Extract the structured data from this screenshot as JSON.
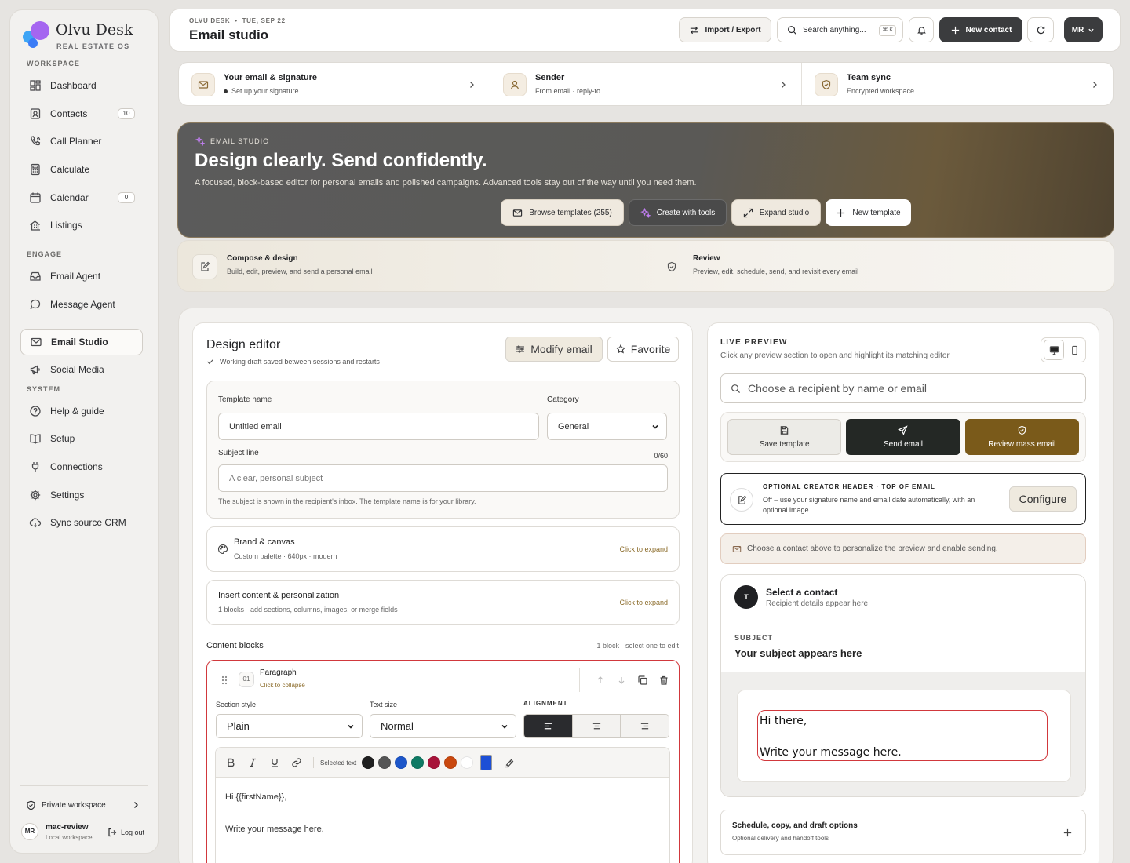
{
  "brand": {
    "name": "Olvu Desk",
    "subtitle": "REAL ESTATE OS"
  },
  "sidebar": {
    "sections": [
      "WORKSPACE",
      "ENGAGE",
      "SYSTEM"
    ],
    "items": [
      {
        "label": "Dashboard",
        "icon": "dashboard-icon"
      },
      {
        "label": "Contacts",
        "icon": "contacts-icon",
        "badge": "10"
      },
      {
        "label": "Call Planner",
        "icon": "phone-icon"
      },
      {
        "label": "Calculate",
        "icon": "calculator-icon"
      },
      {
        "label": "Calendar",
        "icon": "calendar-icon",
        "badge": "0"
      },
      {
        "label": "Listings",
        "icon": "building-icon"
      },
      {
        "label": "Email Agent",
        "icon": "inbox-icon"
      },
      {
        "label": "Message Agent",
        "icon": "chat-icon"
      },
      {
        "label": "Email Studio",
        "icon": "mail-icon",
        "active": true
      },
      {
        "label": "Social Media",
        "icon": "megaphone-icon"
      },
      {
        "label": "Help & guide",
        "icon": "help-icon"
      },
      {
        "label": "Setup",
        "icon": "book-icon"
      },
      {
        "label": "Connections",
        "icon": "plug-icon"
      },
      {
        "label": "Settings",
        "icon": "gear-icon"
      },
      {
        "label": "Sync source CRM",
        "icon": "cloud-sync-icon"
      }
    ],
    "footer": {
      "private_workspace": "Private workspace",
      "avatar": "MR",
      "user_name": "mac-review",
      "user_sub": "Local workspace",
      "logout": "Log out"
    }
  },
  "topbar": {
    "meta_app": "OLVU DESK",
    "meta_date": "TUE, SEP 22",
    "title": "Email studio",
    "import_export": "Import / Export",
    "search_placeholder": "Search anything...",
    "search_shortcut": "⌘ K",
    "new_contact": "New contact",
    "avatar": "MR"
  },
  "setup_cards": [
    {
      "title": "Your email & signature",
      "sub": "Set up your signature",
      "bullet": true
    },
    {
      "title": "Sender",
      "sub": "From email · reply-to"
    },
    {
      "title": "Team sync",
      "sub": "Encrypted workspace"
    }
  ],
  "hero": {
    "kicker": "EMAIL STUDIO",
    "title": "Design clearly. Send confidently.",
    "description": "A focused, block-based editor for personal emails and polished campaigns. Advanced tools stay out of the way until you need them.",
    "buttons": {
      "browse": "Browse templates (255)",
      "create": "Create with tools",
      "expand": "Expand studio",
      "new": "New template"
    }
  },
  "steps": [
    {
      "title": "Compose & design",
      "sub": "Build, edit, preview, and send a personal email"
    },
    {
      "title": "Review",
      "sub": "Preview, edit, schedule, send, and revisit every email"
    }
  ],
  "editor": {
    "title": "Design editor",
    "saved_note": "Working draft saved between sessions and restarts",
    "modify_button": "Modify email",
    "favorite_button": "Favorite",
    "template_name_label": "Template name",
    "template_name_placeholder": "Untitled email",
    "category_label": "Category",
    "category_value": "General",
    "subject_label": "Subject line",
    "subject_count": "0/60",
    "subject_placeholder": "A clear, personal subject",
    "subject_hint": "The subject is shown in the recipient's inbox. The template name is for your library.",
    "brand_canvas": {
      "title": "Brand & canvas",
      "sub": "Custom palette · 640px · modern",
      "action": "Click to expand"
    },
    "insert_content": {
      "title": "Insert content & personalization",
      "sub": "1 blocks · add sections, columns, images, or merge fields",
      "action": "Click to expand"
    },
    "content_blocks_title": "Content blocks",
    "content_blocks_meta": "1 block · select one to edit",
    "block": {
      "number": "01",
      "title": "Paragraph",
      "collapse": "Click to collapse",
      "section_style_label": "Section style",
      "section_style_value": "Plain",
      "text_size_label": "Text size",
      "text_size_value": "Normal",
      "alignment_label": "ALIGNMENT",
      "alignment_selected": "left",
      "selected_text_label": "Selected text",
      "swatches": [
        "#1f1f1f",
        "#555555",
        "#1d56c9",
        "#0f7a64",
        "#a8143a",
        "#c9480e",
        "#ffffff"
      ],
      "picker_color": "#1d4fd6",
      "body_line1": "Hi {{firstName}},",
      "body_line2": "Write your message here."
    }
  },
  "preview": {
    "kicker": "LIVE PREVIEW",
    "sub": "Click any preview section to open and highlight its matching editor",
    "device_selected": "desktop",
    "recipient_placeholder": "Choose a recipient by name or email",
    "actions": {
      "save": "Save template",
      "send": "Send email",
      "review": "Review mass email"
    },
    "creator_title": "OPTIONAL CREATOR HEADER · TOP OF EMAIL",
    "creator_desc": "Off – use your signature name and email date automatically, with an optional image.",
    "configure": "Configure",
    "notice": "Choose a contact above to personalize the preview and enable sending.",
    "contact_avatar": "T",
    "contact_title": "Select a contact",
    "contact_sub": "Recipient details appear here",
    "subject_key": "SUBJECT",
    "subject_value": "Your subject appears here",
    "body_line1": "Hi there,",
    "body_line2": "Write your message here.",
    "schedule_title": "Schedule, copy, and draft options",
    "schedule_sub": "Optional delivery and handoff tools"
  },
  "colors": {
    "accent_gold": "#7a5a1a",
    "active_outline": "#d1383c",
    "dark_button": "#3b3c3e"
  }
}
